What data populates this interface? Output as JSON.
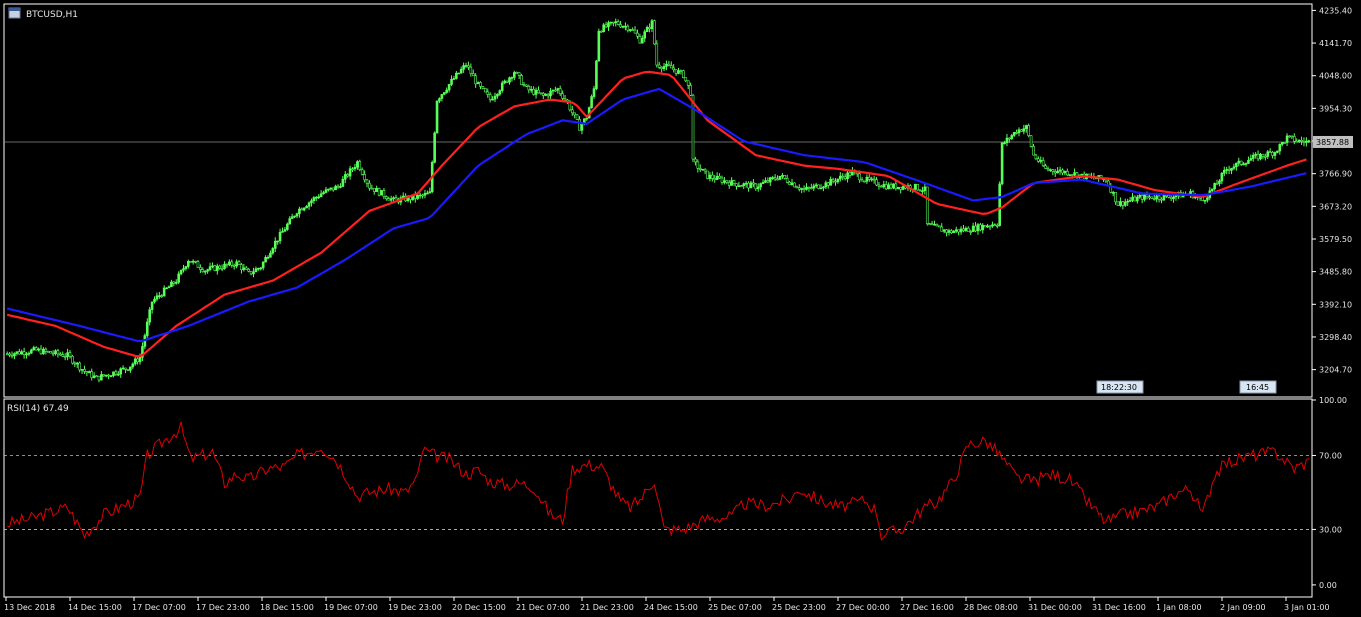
{
  "main_panel": {
    "title": "BTCUSD,H1",
    "current_price_label": "3857.88",
    "time_markers": [
      "18:22:30",
      "16:45"
    ]
  },
  "rsi_panel": {
    "title": "RSI(14) 67.49"
  },
  "colors": {
    "background": "#000000",
    "candle": "#59ff59",
    "ma_fast": "#ff2020",
    "ma_slow": "#1a1aff",
    "rsi": "#e00000",
    "axis_text": "#e6e6e6",
    "frame": "#ffffff"
  },
  "chart_data": [
    {
      "type": "candlestick",
      "title": "BTCUSD,H1",
      "x_tick_labels": [
        "13 Dec 2018",
        "14 Dec 15:00",
        "17 Dec 07:00",
        "17 Dec 23:00",
        "18 Dec 15:00",
        "19 Dec 07:00",
        "19 Dec 23:00",
        "20 Dec 15:00",
        "21 Dec 07:00",
        "21 Dec 23:00",
        "24 Dec 15:00",
        "25 Dec 07:00",
        "25 Dec 23:00",
        "27 Dec 00:00",
        "27 Dec 16:00",
        "28 Dec 08:00",
        "31 Dec 00:00",
        "31 Dec 16:00",
        "1 Jan 08:00",
        "2 Jan 09:00",
        "3 Jan 01:00"
      ],
      "y_tick_labels": [
        "4235.40",
        "4141.70",
        "4048.00",
        "3954.30",
        "3860.60",
        "3766.90",
        "3673.20",
        "3579.50",
        "3485.80",
        "3392.10",
        "3298.40",
        "3204.70"
      ],
      "y_ticks": [
        4235.4,
        4141.7,
        4048.0,
        3954.3,
        3860.6,
        3766.9,
        3673.2,
        3579.5,
        3485.8,
        3392.1,
        3298.4,
        3204.7
      ],
      "ylim": [
        3129,
        4248
      ],
      "current_price": 3857.88,
      "close_profile": [
        [
          0,
          3250
        ],
        [
          12,
          3260
        ],
        [
          25,
          3245
        ],
        [
          32,
          3200
        ],
        [
          37,
          3180
        ],
        [
          50,
          3210
        ],
        [
          55,
          3240
        ],
        [
          60,
          3400
        ],
        [
          70,
          3460
        ],
        [
          75,
          3520
        ],
        [
          82,
          3490
        ],
        [
          95,
          3510
        ],
        [
          100,
          3480
        ],
        [
          105,
          3500
        ],
        [
          110,
          3560
        ],
        [
          115,
          3610
        ],
        [
          120,
          3660
        ],
        [
          130,
          3710
        ],
        [
          137,
          3730
        ],
        [
          145,
          3800
        ],
        [
          150,
          3730
        ],
        [
          160,
          3690
        ],
        [
          170,
          3700
        ],
        [
          175,
          3710
        ],
        [
          178,
          3980
        ],
        [
          185,
          4040
        ],
        [
          190,
          4080
        ],
        [
          195,
          4020
        ],
        [
          200,
          3980
        ],
        [
          205,
          4020
        ],
        [
          210,
          4060
        ],
        [
          215,
          4010
        ],
        [
          222,
          3990
        ],
        [
          228,
          4010
        ],
        [
          232,
          3970
        ],
        [
          237,
          3900
        ],
        [
          240,
          3930
        ],
        [
          243,
          4010
        ],
        [
          245,
          4180
        ],
        [
          252,
          4200
        ],
        [
          258,
          4185
        ],
        [
          262,
          4150
        ],
        [
          267,
          4200
        ],
        [
          269,
          4080
        ],
        [
          275,
          4070
        ],
        [
          280,
          4050
        ],
        [
          283,
          4000
        ],
        [
          284,
          3800
        ],
        [
          290,
          3760
        ],
        [
          300,
          3740
        ],
        [
          310,
          3730
        ],
        [
          320,
          3760
        ],
        [
          330,
          3720
        ],
        [
          340,
          3740
        ],
        [
          350,
          3770
        ],
        [
          355,
          3750
        ],
        [
          365,
          3730
        ],
        [
          375,
          3730
        ],
        [
          380,
          3720
        ],
        [
          381,
          3620
        ],
        [
          390,
          3600
        ],
        [
          400,
          3610
        ],
        [
          410,
          3625
        ],
        [
          412,
          3850
        ],
        [
          418,
          3890
        ],
        [
          422,
          3900
        ],
        [
          425,
          3820
        ],
        [
          430,
          3780
        ],
        [
          440,
          3770
        ],
        [
          445,
          3760
        ],
        [
          455,
          3750
        ],
        [
          460,
          3680
        ],
        [
          470,
          3700
        ],
        [
          480,
          3700
        ],
        [
          490,
          3710
        ],
        [
          495,
          3690
        ],
        [
          500,
          3730
        ],
        [
          505,
          3780
        ],
        [
          515,
          3810
        ],
        [
          525,
          3830
        ],
        [
          530,
          3870
        ],
        [
          535,
          3860
        ],
        [
          539,
          3858
        ]
      ],
      "series": [
        {
          "name": "",
          "profile": [
            [
              0,
              3362
            ],
            [
              20,
              3330
            ],
            [
              40,
              3270
            ],
            [
              55,
              3240
            ],
            [
              70,
              3330
            ],
            [
              90,
              3420
            ],
            [
              110,
              3460
            ],
            [
              130,
              3540
            ],
            [
              150,
              3660
            ],
            [
              170,
              3710
            ],
            [
              180,
              3790
            ],
            [
              195,
              3900
            ],
            [
              210,
              3960
            ],
            [
              225,
              3980
            ],
            [
              235,
              3970
            ],
            [
              240,
              3930
            ],
            [
              255,
              4040
            ],
            [
              265,
              4060
            ],
            [
              275,
              4050
            ],
            [
              290,
              3920
            ],
            [
              310,
              3820
            ],
            [
              330,
              3790
            ],
            [
              345,
              3780
            ],
            [
              365,
              3760
            ],
            [
              385,
              3680
            ],
            [
              405,
              3650
            ],
            [
              412,
              3670
            ],
            [
              425,
              3740
            ],
            [
              445,
              3760
            ],
            [
              460,
              3750
            ],
            [
              475,
              3720
            ],
            [
              495,
              3700
            ],
            [
              510,
              3740
            ],
            [
              530,
              3790
            ],
            [
              539,
              3810
            ]
          ]
        },
        {
          "name": "",
          "profile": [
            [
              0,
              3380
            ],
            [
              30,
              3330
            ],
            [
              55,
              3285
            ],
            [
              75,
              3330
            ],
            [
              100,
              3400
            ],
            [
              120,
              3440
            ],
            [
              140,
              3520
            ],
            [
              160,
              3610
            ],
            [
              175,
              3640
            ],
            [
              195,
              3790
            ],
            [
              215,
              3880
            ],
            [
              230,
              3920
            ],
            [
              240,
              3910
            ],
            [
              255,
              3980
            ],
            [
              270,
              4010
            ],
            [
              285,
              3950
            ],
            [
              305,
              3860
            ],
            [
              330,
              3820
            ],
            [
              355,
              3800
            ],
            [
              380,
              3740
            ],
            [
              400,
              3690
            ],
            [
              412,
              3700
            ],
            [
              425,
              3740
            ],
            [
              445,
              3750
            ],
            [
              470,
              3710
            ],
            [
              495,
              3705
            ],
            [
              515,
              3730
            ],
            [
              539,
              3770
            ]
          ]
        }
      ]
    },
    {
      "type": "line",
      "title": "RSI(14) 67.49",
      "y_tick_labels": [
        "100.00",
        "70.00",
        "30.00",
        "0.00"
      ],
      "y_ticks": [
        100,
        70,
        30,
        0
      ],
      "ylim": [
        -6,
        100
      ],
      "levels": [
        70,
        30
      ],
      "series": [
        {
          "name": "RSI(14)",
          "profile": [
            [
              0,
              33
            ],
            [
              10,
              36
            ],
            [
              25,
              42
            ],
            [
              32,
              27
            ],
            [
              40,
              38
            ],
            [
              55,
              47
            ],
            [
              58,
              70
            ],
            [
              65,
              78
            ],
            [
              72,
              85
            ],
            [
              76,
              68
            ],
            [
              85,
              72
            ],
            [
              90,
              55
            ],
            [
              95,
              60
            ],
            [
              100,
              57
            ],
            [
              108,
              63
            ],
            [
              115,
              64
            ],
            [
              120,
              70
            ],
            [
              125,
              72
            ],
            [
              130,
              75
            ],
            [
              136,
              68
            ],
            [
              140,
              60
            ],
            [
              145,
              48
            ],
            [
              150,
              50
            ],
            [
              158,
              52
            ],
            [
              165,
              50
            ],
            [
              170,
              58
            ],
            [
              172,
              73
            ],
            [
              177,
              70
            ],
            [
              183,
              68
            ],
            [
              190,
              60
            ],
            [
              195,
              62
            ],
            [
              200,
              56
            ],
            [
              207,
              54
            ],
            [
              213,
              55
            ],
            [
              218,
              53
            ],
            [
              225,
              38
            ],
            [
              230,
              35
            ],
            [
              234,
              63
            ],
            [
              240,
              65
            ],
            [
              246,
              64
            ],
            [
              254,
              45
            ],
            [
              258,
              42
            ],
            [
              262,
              46
            ],
            [
              268,
              57
            ],
            [
              272,
              30
            ],
            [
              280,
              30
            ],
            [
              290,
              36
            ],
            [
              300,
              37
            ],
            [
              305,
              44
            ],
            [
              315,
              43
            ],
            [
              325,
              47
            ],
            [
              328,
              52
            ],
            [
              336,
              46
            ],
            [
              345,
              42
            ],
            [
              355,
              46
            ],
            [
              360,
              40
            ],
            [
              362,
              27
            ],
            [
              370,
              30
            ],
            [
              380,
              42
            ],
            [
              385,
              45
            ],
            [
              392,
              57
            ],
            [
              398,
              76
            ],
            [
              405,
              78
            ],
            [
              410,
              72
            ],
            [
              418,
              58
            ],
            [
              425,
              56
            ],
            [
              432,
              60
            ],
            [
              440,
              57
            ],
            [
              448,
              44
            ],
            [
              455,
              34
            ],
            [
              462,
              38
            ],
            [
              470,
              40
            ],
            [
              477,
              43
            ],
            [
              484,
              50
            ],
            [
              490,
              52
            ],
            [
              495,
              38
            ],
            [
              500,
              60
            ],
            [
              505,
              66
            ],
            [
              515,
              70
            ],
            [
              525,
              72
            ],
            [
              533,
              63
            ],
            [
              539,
              67
            ]
          ]
        }
      ]
    }
  ]
}
